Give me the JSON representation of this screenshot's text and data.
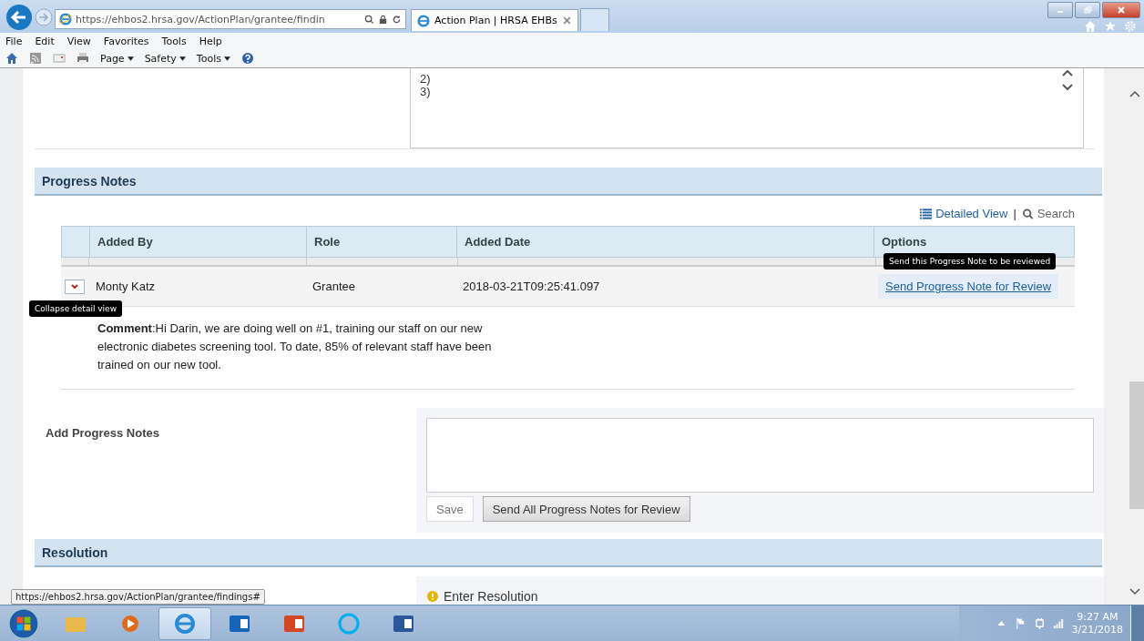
{
  "browser": {
    "address": "https://ehbos2.hrsa.gov/ActionPlan/grantee/findin",
    "tab_title": "Action Plan | HRSA EHBs",
    "menu": [
      "File",
      "Edit",
      "View",
      "Favorites",
      "Tools",
      "Help"
    ],
    "command_bar": [
      "Page",
      "Safety",
      "Tools"
    ]
  },
  "top_textarea_lines": [
    "2)",
    "3)"
  ],
  "progress_notes": {
    "title": "Progress Notes",
    "view_links": [
      {
        "kind": "list",
        "label": "Detailed View"
      },
      {
        "kind": "search",
        "label": "Search"
      }
    ],
    "separator": "|",
    "columns": [
      "Added By",
      "Role",
      "Added Date",
      "Options"
    ],
    "rows": [
      {
        "expanded": true,
        "added_by": "Monty Katz",
        "role": "Grantee",
        "added_date": "2018-03-21T09:25:41.097",
        "action": "Send Progress Note for Review",
        "comment": "**Comment**:Hi Darin, we are doing well on #1, training our staff on our new electronic diabetes screening tool. To date, 85% of relevant staff have been trained on our new tool."
      }
    ]
  },
  "tooltips": {
    "toggle": "Collapse detail view",
    "action": "Send this Progress Note to be reviewed"
  },
  "add_notes": {
    "label": "Add Progress Notes",
    "buttons": [
      {
        "kind": "plain",
        "label": "Save"
      },
      {
        "kind": "raised",
        "label": "Send All Progress Notes for Review"
      }
    ]
  },
  "resolution": {
    "title": "Resolution",
    "prompt": "Enter Resolution"
  },
  "status_url": "https://ehbos2.hrsa.gov/ActionPlan/grantee/findings#",
  "taskbar": {
    "apps": [
      {
        "kind": "folder",
        "selected": false
      },
      {
        "kind": "player",
        "selected": false
      },
      {
        "kind": "browser",
        "selected": true
      },
      {
        "kind": "mail",
        "selected": false
      },
      {
        "kind": "slides",
        "selected": false
      },
      {
        "kind": "chat",
        "selected": false
      },
      {
        "kind": "doc",
        "selected": false
      }
    ],
    "clock": {
      "time": "9:27 AM",
      "date": "3/21/2018"
    }
  }
}
